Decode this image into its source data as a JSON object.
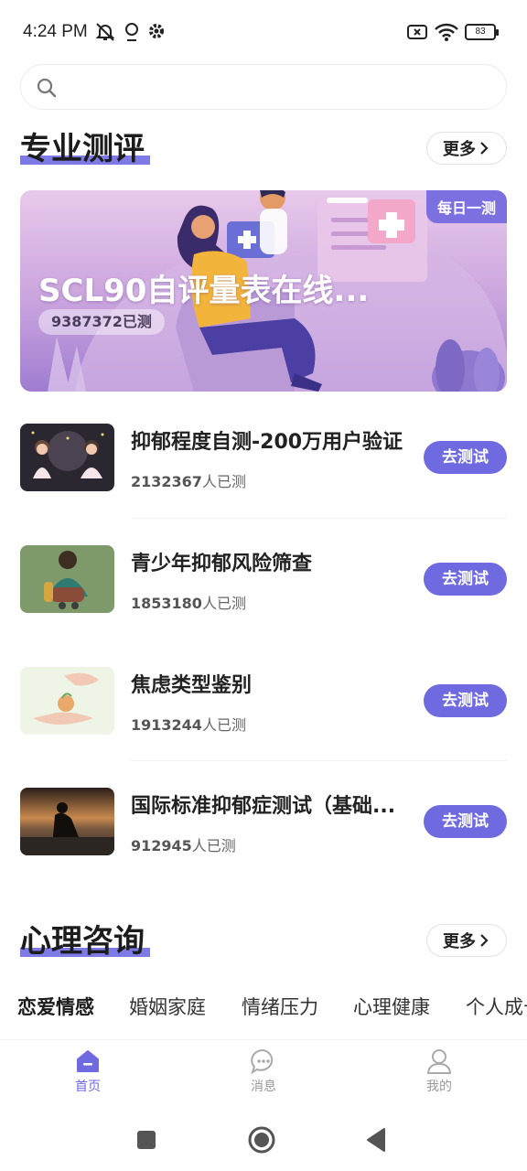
{
  "status_bar": {
    "time": "4:24 PM",
    "icons": [
      "mute-icon",
      "location-icon",
      "settings-icon",
      "sim-off-icon",
      "wifi-icon"
    ],
    "battery": "83"
  },
  "search": {
    "placeholder": ""
  },
  "professional": {
    "title": "专业测评",
    "more": "更多",
    "banner": {
      "badge": "每日一测",
      "title": "SCL90自评量表在线...",
      "count": "9387372已测"
    },
    "tests": [
      {
        "name": "抑郁程度自测-200万用户验证",
        "count": "2132367",
        "suffix": "人已测",
        "button": "去测试"
      },
      {
        "name": "青少年抑郁风险筛查",
        "count": "1853180",
        "suffix": "人已测",
        "button": "去测试"
      },
      {
        "name": "焦虑类型鉴别",
        "count": "1913244",
        "suffix": "人已测",
        "button": "去测试"
      },
      {
        "name": "国际标准抑郁症测试（基础...",
        "count": "912945",
        "suffix": "人已测",
        "button": "去测试"
      }
    ]
  },
  "consult": {
    "title": "心理咨询",
    "more": "更多",
    "tabs": [
      "恋爱情感",
      "婚姻家庭",
      "情绪压力",
      "心理健康",
      "个人成长"
    ]
  },
  "bottom_nav": {
    "items": [
      {
        "label": "首页",
        "icon": "home-icon"
      },
      {
        "label": "消息",
        "icon": "message-icon"
      },
      {
        "label": "我的",
        "icon": "profile-icon"
      }
    ],
    "active_color": "#6f6ae0"
  },
  "colors": {
    "accent": "#6f6ae0",
    "underline": "#7d7ae6"
  }
}
